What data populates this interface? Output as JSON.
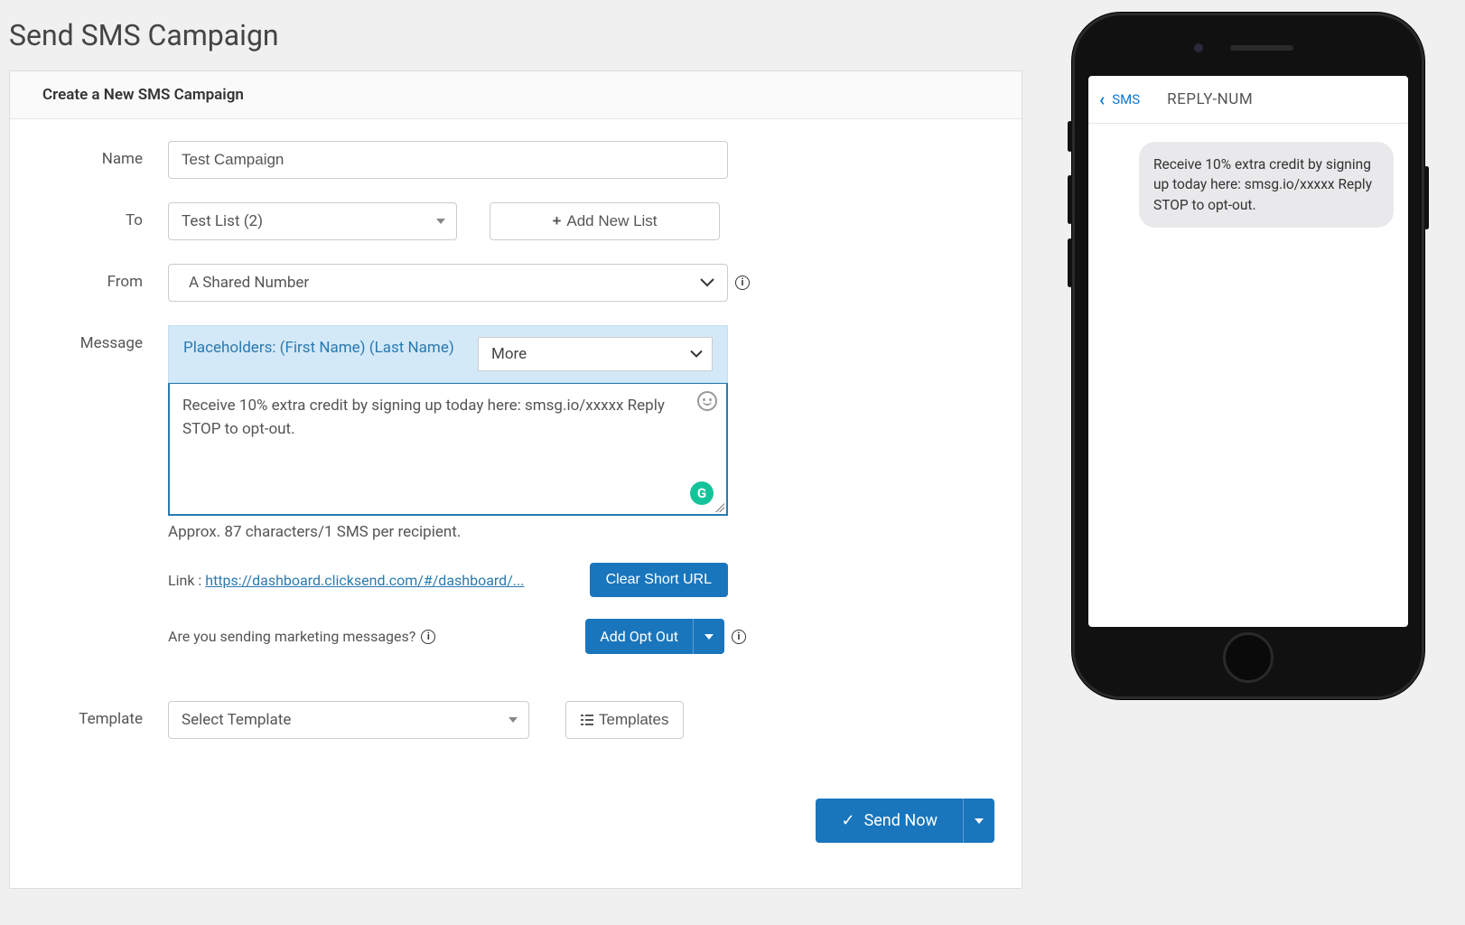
{
  "page": {
    "title": "Send SMS Campaign"
  },
  "card": {
    "header": "Create a New SMS Campaign"
  },
  "form": {
    "name": {
      "label": "Name",
      "value": "Test Campaign"
    },
    "to": {
      "label": "To",
      "selected": "Test List (2)",
      "add_list_label": "Add New List"
    },
    "from": {
      "label": "From",
      "selected": "A Shared Number"
    },
    "message": {
      "label": "Message",
      "placeholders_text": "Placeholders: (First Name) (Last Name)",
      "more_label": "More",
      "value": "Receive 10% extra credit by signing up today here: smsg.io/xxxxx Reply STOP to opt-out.",
      "char_count": "Approx. 87 characters/1 SMS per recipient."
    },
    "link": {
      "label": "Link :",
      "url": "https://dashboard.clicksend.com/#/dashboard/...",
      "clear_label": "Clear Short URL"
    },
    "marketing": {
      "question": "Are you sending marketing messages?",
      "opt_out_label": "Add Opt Out"
    },
    "template": {
      "label": "Template",
      "selected": "Select Template",
      "templates_btn": "Templates"
    },
    "send": {
      "label": "Send Now"
    }
  },
  "preview": {
    "back_label": "SMS",
    "title": "REPLY-NUM",
    "bubble": "Receive 10% extra credit by signing up today here: smsg.io/xxxxx Reply STOP to opt-out."
  },
  "icons": {
    "plus": "+",
    "check": "✓",
    "info": "i",
    "grammarly": "G",
    "chevron_left": "‹"
  }
}
